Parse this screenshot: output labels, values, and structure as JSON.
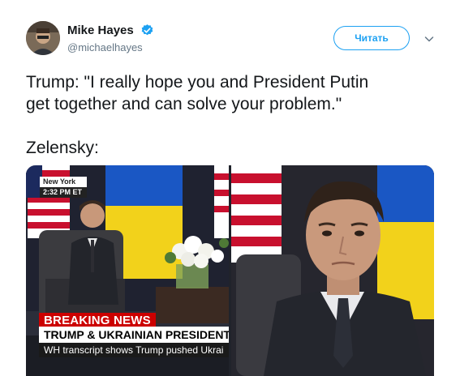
{
  "tweet": {
    "author": {
      "display_name": "Mike Hayes",
      "handle": "@michaelhayes",
      "verified": true
    },
    "follow_button_label": "Читать",
    "text": "Trump: \"I really hope you and President Putin\nget together and can solve your problem.\"\n\nZelensky:",
    "media": {
      "left_image": {
        "location_city": "New York",
        "location_time": "2:32 PM ET",
        "breaking_label": "BREAKING NEWS",
        "headline": "TRUMP & UKRAINIAN PRESIDENT MEET AM",
        "subline": "WH transcript shows Trump pushed Ukrai"
      }
    },
    "colors": {
      "accent": "#1da1f2",
      "breaking_red": "#cc0000",
      "text_primary": "#14171a",
      "text_secondary": "#657786"
    },
    "icons": {
      "verified": "verified-badge-icon",
      "caret": "chevron-down-icon"
    }
  }
}
